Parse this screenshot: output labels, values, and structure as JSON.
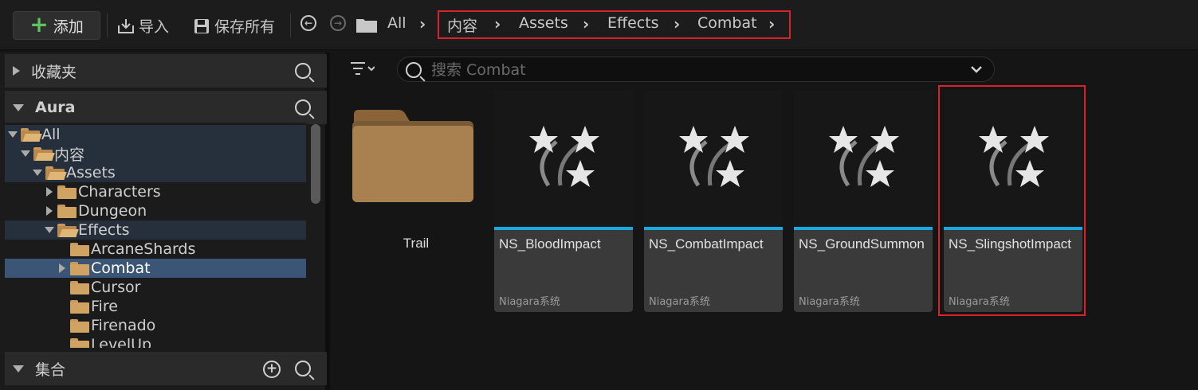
{
  "toolbar": {
    "add_label": "添加",
    "import_label": "导入",
    "save_all_label": "保存所有",
    "path_root": "All",
    "breadcrumb": [
      "内容",
      "Assets",
      "Effects",
      "Combat"
    ]
  },
  "left_panel": {
    "favorites_label": "收藏夹",
    "project_label": "Aura",
    "collections_label": "集合",
    "tree": [
      {
        "label": "All",
        "expanded": true
      },
      {
        "label": "内容",
        "expanded": true
      },
      {
        "label": "Assets",
        "expanded": true
      },
      {
        "label": "Characters",
        "expanded": false
      },
      {
        "label": "Dungeon",
        "expanded": false
      },
      {
        "label": "Effects",
        "expanded": true
      },
      {
        "label": "ArcaneShards",
        "expanded": false
      },
      {
        "label": "Combat",
        "expanded": false,
        "selected": true
      },
      {
        "label": "Cursor",
        "expanded": false
      },
      {
        "label": "Fire",
        "expanded": false
      },
      {
        "label": "Firenado",
        "expanded": false
      },
      {
        "label": "LevelUp",
        "expanded": false
      }
    ]
  },
  "content": {
    "search_placeholder": "搜索 Combat",
    "folder": {
      "label": "Trail"
    },
    "assets": [
      {
        "name": "NS_BloodImpact",
        "type": "Niagara系统"
      },
      {
        "name": "NS_CombatImpact",
        "type": "Niagara系统"
      },
      {
        "name": "NS_GroundSummon",
        "type": "Niagara系统"
      },
      {
        "name": "NS_SlingshotImpact",
        "type": "Niagara系统"
      }
    ]
  },
  "colors": {
    "accent_bar": "#19a8e0",
    "highlight_box": "#d8232a",
    "selection": "#3a5576",
    "folder": "#d0a363"
  },
  "icons": [
    "plus-icon",
    "import-icon",
    "save-icon",
    "back-icon",
    "forward-icon",
    "folder-icon",
    "chevron-right-icon",
    "search-icon",
    "filter-icon",
    "chevron-down-icon",
    "niagara-system-icon",
    "add-circle-icon"
  ]
}
